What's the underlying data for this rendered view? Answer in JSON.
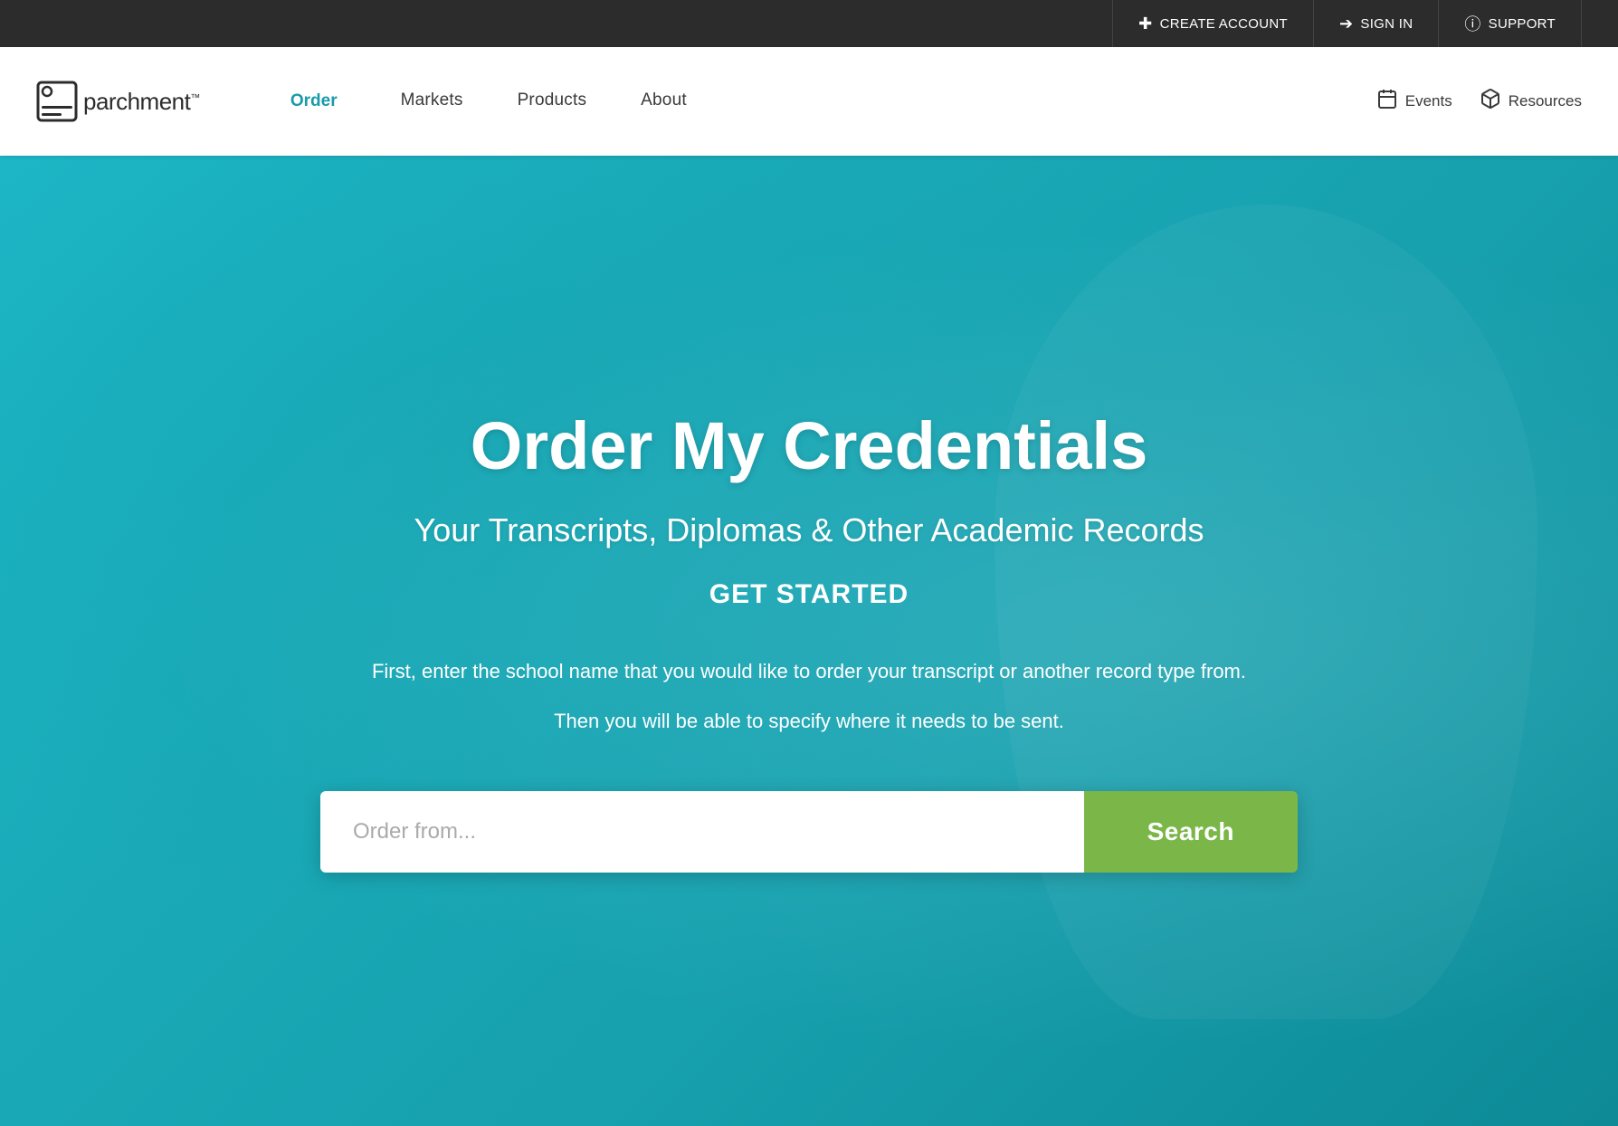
{
  "topbar": {
    "create_account_label": "CREATE ACCOUNT",
    "sign_in_label": "SIGN IN",
    "support_label": "SUPPORT"
  },
  "nav": {
    "logo_text": "parchment",
    "logo_sup": "™",
    "links": [
      {
        "id": "order",
        "label": "Order",
        "active": true
      },
      {
        "id": "markets",
        "label": "Markets",
        "active": false
      },
      {
        "id": "products",
        "label": "Products",
        "active": false
      },
      {
        "id": "about",
        "label": "About",
        "active": false
      }
    ],
    "right_links": [
      {
        "id": "events",
        "label": "Events"
      },
      {
        "id": "resources",
        "label": "Resources"
      }
    ]
  },
  "hero": {
    "title": "Order My Credentials",
    "subtitle": "Your Transcripts, Diplomas & Other Academic Records",
    "cta": "GET STARTED",
    "description1": "First, enter the school name that you would like to order your transcript or another record type from.",
    "description2": "Then you will be able to specify where it needs to be sent.",
    "search_placeholder": "Order from...",
    "search_button_label": "Search"
  }
}
